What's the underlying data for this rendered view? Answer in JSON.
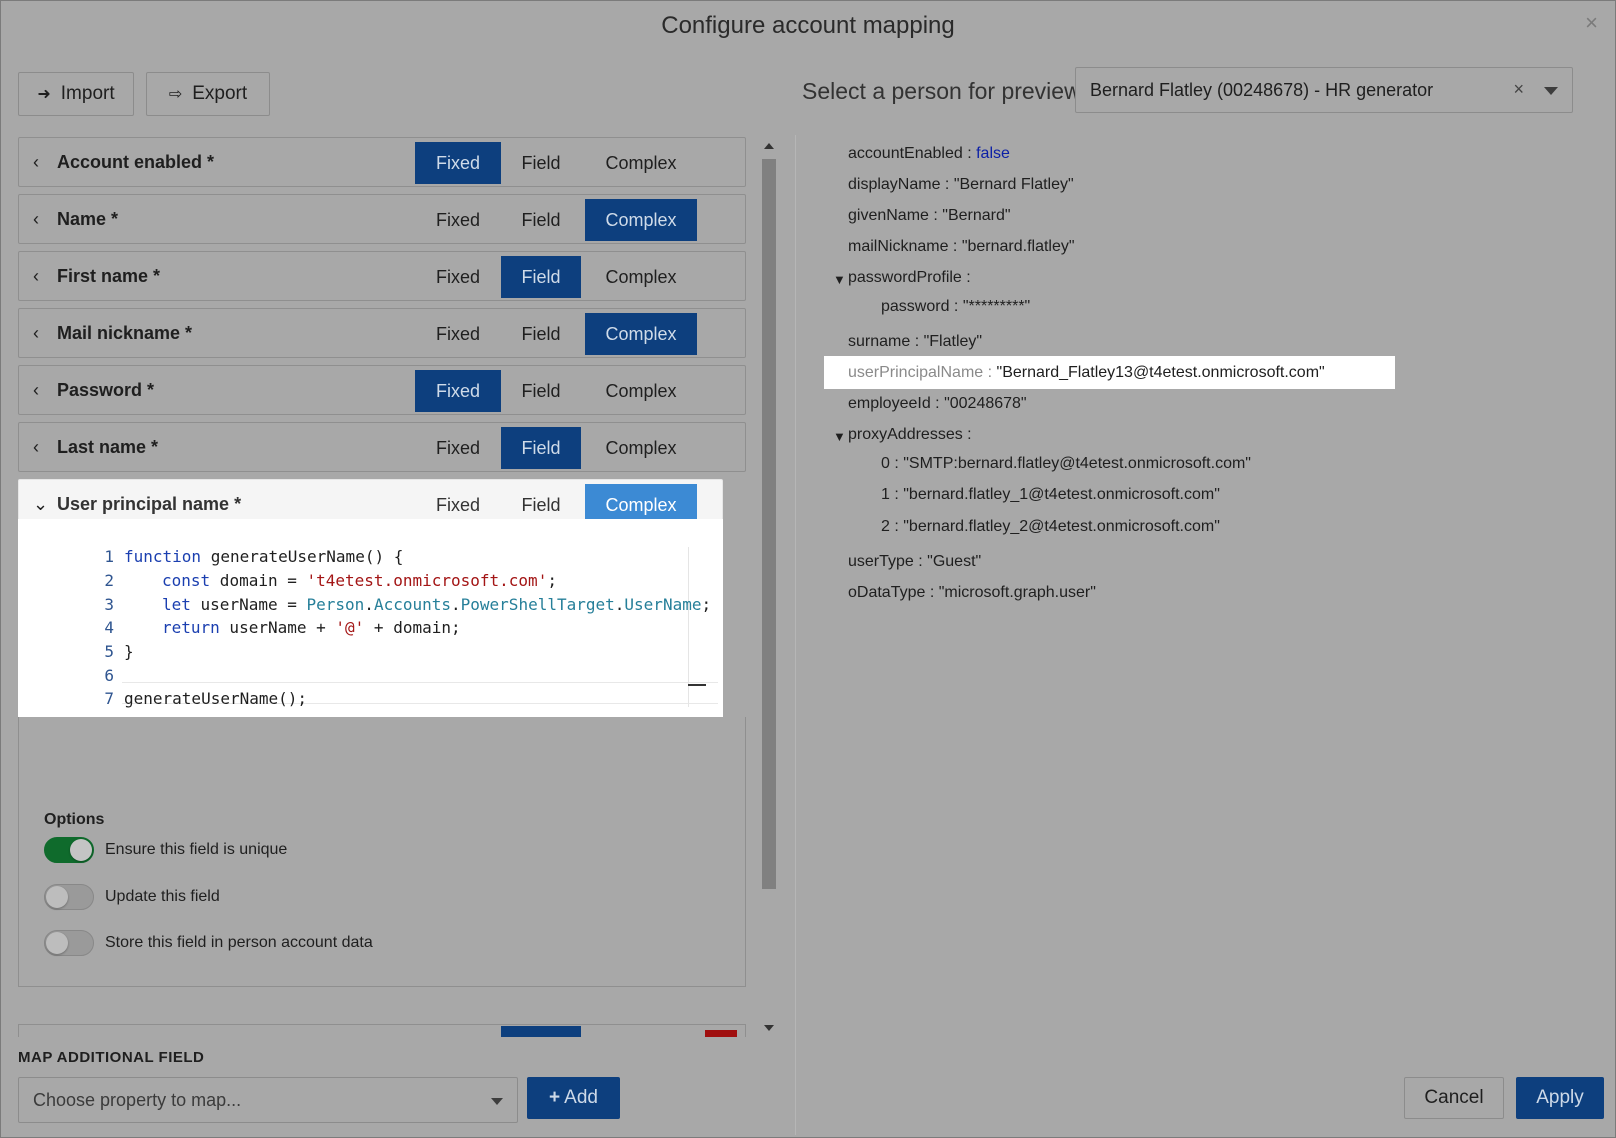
{
  "dialog": {
    "title": "Configure account mapping",
    "close_glyph": "×"
  },
  "toolbar": {
    "import_label": "Import",
    "export_label": "Export"
  },
  "preview_selector": {
    "label": "Select a person for preview",
    "value": "Bernard Flatley (00248678) - HR generator",
    "clear_glyph": "×"
  },
  "segments": {
    "fixed": "Fixed",
    "field": "Field",
    "complex": "Complex"
  },
  "mappings": [
    {
      "label": "Account enabled *",
      "active": "fixed"
    },
    {
      "label": "Name *",
      "active": "complex"
    },
    {
      "label": "First name *",
      "active": "field"
    },
    {
      "label": "Mail nickname *",
      "active": "complex"
    },
    {
      "label": "Password *",
      "active": "fixed"
    },
    {
      "label": "Last name *",
      "active": "field"
    },
    {
      "label": "User principal name *",
      "active": "complex",
      "expanded": true
    }
  ],
  "editor": {
    "line_numbers": [
      "1",
      "2",
      "3",
      "4",
      "5",
      "6",
      "7"
    ],
    "tokens": {
      "l1_kw": "function",
      "l1_rest": " generateUserName() {",
      "l2_kw": "const",
      "l2_mid": " domain = ",
      "l2_str": "'t4etest.onmicrosoft.com'",
      "l2_end": ";",
      "l3_kw": "let",
      "l3_mid": " userName = ",
      "l3_p1": "Person",
      "l3_d1": ".",
      "l3_p2": "Accounts",
      "l3_d2": ".",
      "l3_p3": "PowerShellTarget",
      "l3_d3": ".",
      "l3_p4": "UserName",
      "l3_end": ";",
      "l4_kw": "return",
      "l4_mid": " userName + ",
      "l4_str": "'@'",
      "l4_end": " + domain;",
      "l5": "}",
      "l7": "generateUserName();"
    }
  },
  "options": {
    "title": "Options",
    "items": [
      {
        "label": "Ensure this field is unique",
        "on": true
      },
      {
        "label": "Update this field",
        "on": false
      },
      {
        "label": "Store this field in person account data",
        "on": false
      }
    ]
  },
  "preview": {
    "accountEnabled_key": "accountEnabled",
    "accountEnabled_val": "false",
    "displayName_key": "displayName",
    "displayName_val": "\"Bernard Flatley\"",
    "givenName_key": "givenName",
    "givenName_val": "\"Bernard\"",
    "mailNickname_key": "mailNickname",
    "mailNickname_val": "\"bernard.flatley\"",
    "passwordProfile_key": "passwordProfile",
    "password_key": "password",
    "password_val": "\"*********\"",
    "surname_key": "surname",
    "surname_val": "\"Flatley\"",
    "userPrincipalName_key": "userPrincipalName",
    "userPrincipalName_val": "\"Bernard_Flatley13@t4etest.onmicrosoft.com\"",
    "employeeId_key": "employeeId",
    "employeeId_val": "\"00248678\"",
    "proxyAddresses_key": "proxyAddresses",
    "proxy_0_key": "0",
    "proxy_0_val": "\"SMTP:bernard.flatley@t4etest.onmicrosoft.com\"",
    "proxy_1_key": "1",
    "proxy_1_val": "\"bernard.flatley_1@t4etest.onmicrosoft.com\"",
    "proxy_2_key": "2",
    "proxy_2_val": "\"bernard.flatley_2@t4etest.onmicrosoft.com\"",
    "userType_key": "userType",
    "userType_val": "\"Guest\"",
    "oDataType_key": "oDataType",
    "oDataType_val": "\"microsoft.graph.user\"",
    "sep": " : ",
    "expand_glyph": "▼"
  },
  "footer": {
    "map_additional_label": "MAP ADDITIONAL FIELD",
    "choose_placeholder": "Choose property to map...",
    "add_label": "Add",
    "add_glyph": "+",
    "cancel_label": "Cancel",
    "apply_label": "Apply"
  },
  "colors": {
    "accent": "#0d3f7e",
    "accent_light": "#3c8ad4",
    "toggle_on": "#0f6b2c",
    "bool_value": "#0b1fa6"
  }
}
